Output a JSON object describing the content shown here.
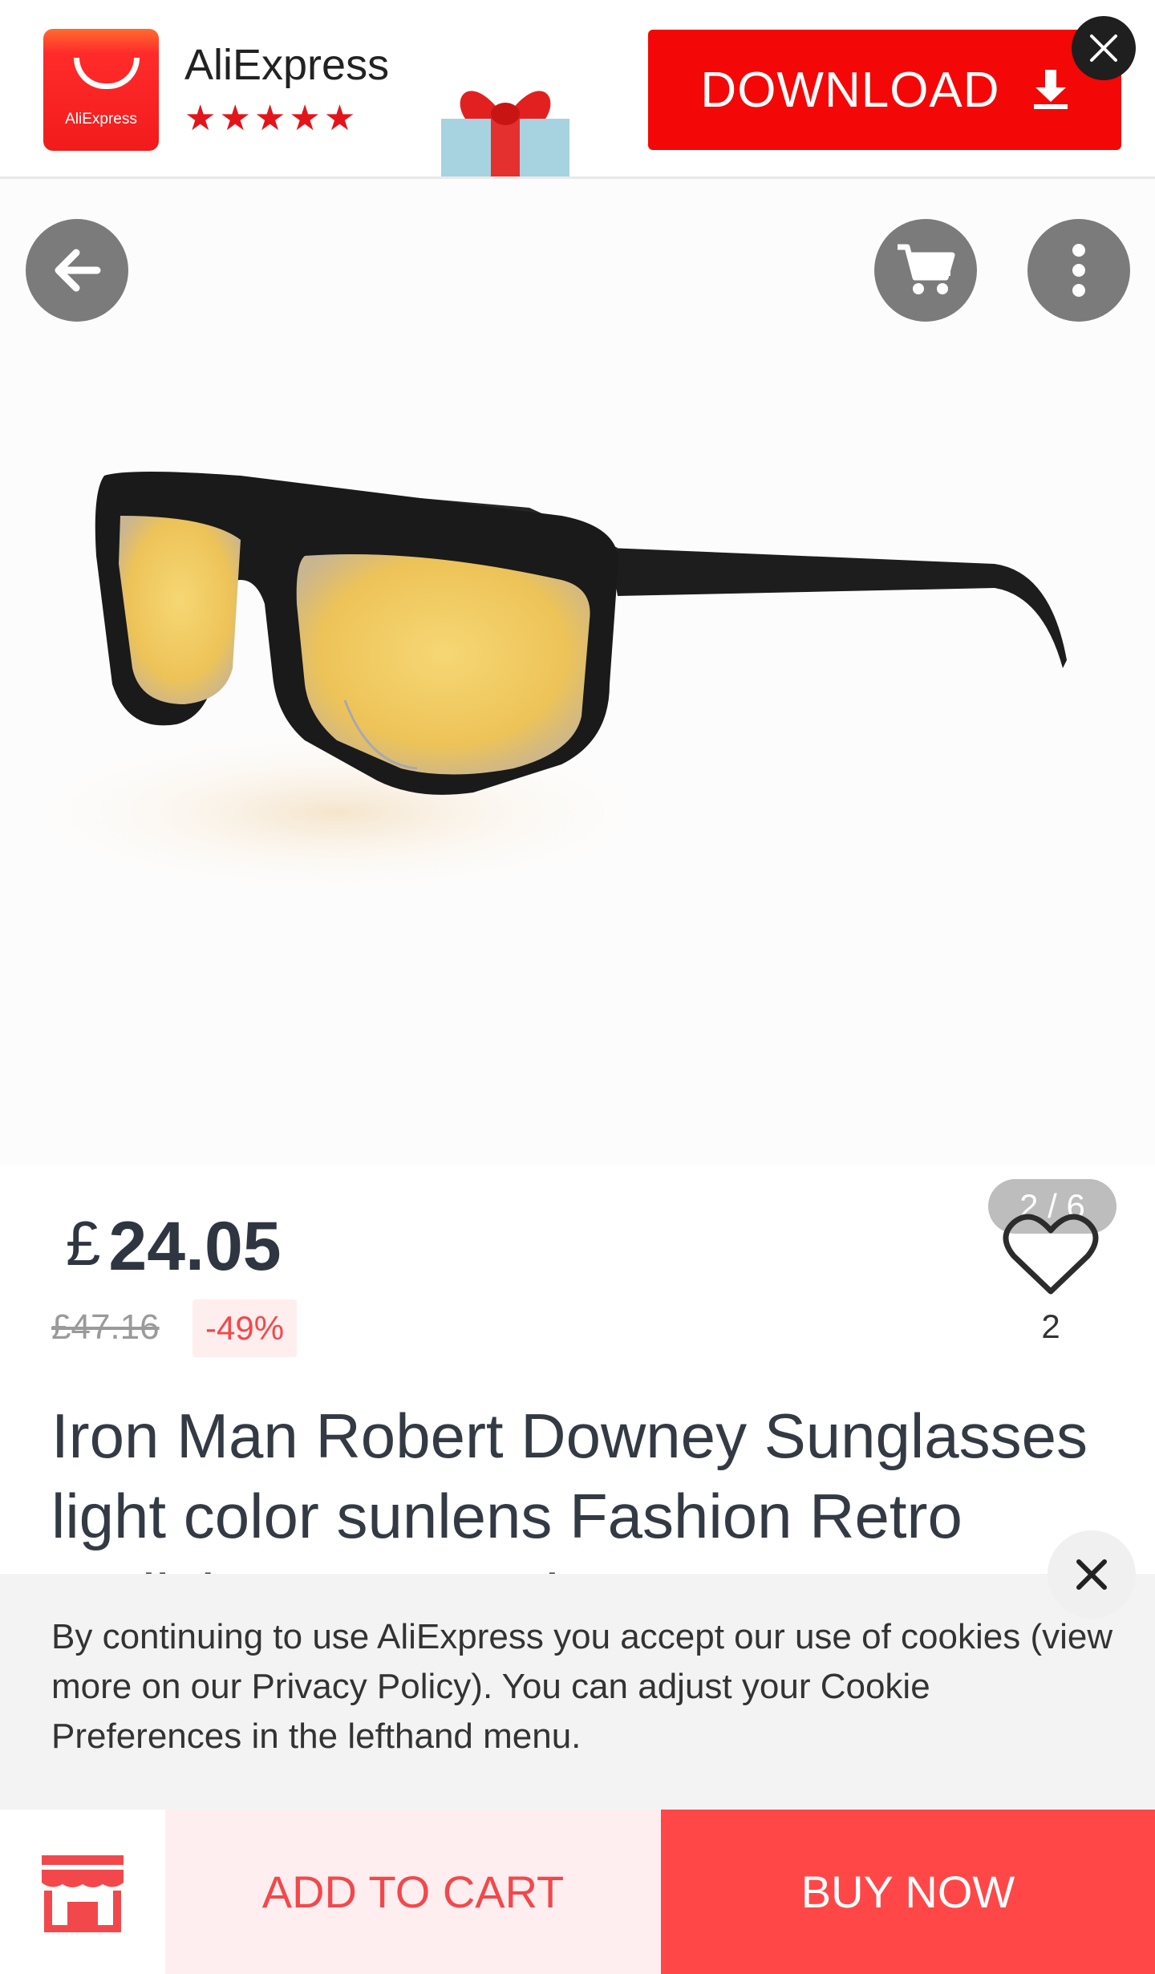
{
  "banner": {
    "logo_text": "AliExpress",
    "app_name": "AliExpress",
    "rating_stars": "★★★★★",
    "rating_value": 4.5,
    "download_label": "DOWNLOAD"
  },
  "gallery": {
    "image_counter": "2 / 6"
  },
  "price": {
    "currency": "£",
    "value": "24.05",
    "old_price": "£47.16",
    "discount": "-49%"
  },
  "wishlist": {
    "count": "2"
  },
  "product": {
    "title": "Iron Man Robert Downey Sunglasses light color sunlens Fashion Retro Stylish Men Brand"
  },
  "cookie": {
    "text": "By continuing to use AliExpress you accept our use of cookies (view more on our Privacy Policy). You can adjust your Cookie Preferences in the lefthand menu."
  },
  "actions": {
    "add_to_cart": "ADD TO CART",
    "buy_now": "BUY NOW"
  },
  "colors": {
    "brand_red": "#f40707",
    "buy_now": "#ff4747",
    "add_to_cart_bg": "#feeeef",
    "discount_text": "#f2484c"
  },
  "icons": [
    "back-arrow-icon",
    "cart-icon",
    "more-vertical-icon",
    "heart-icon",
    "close-icon",
    "store-icon",
    "download-arrow-icon",
    "gift-icon"
  ]
}
